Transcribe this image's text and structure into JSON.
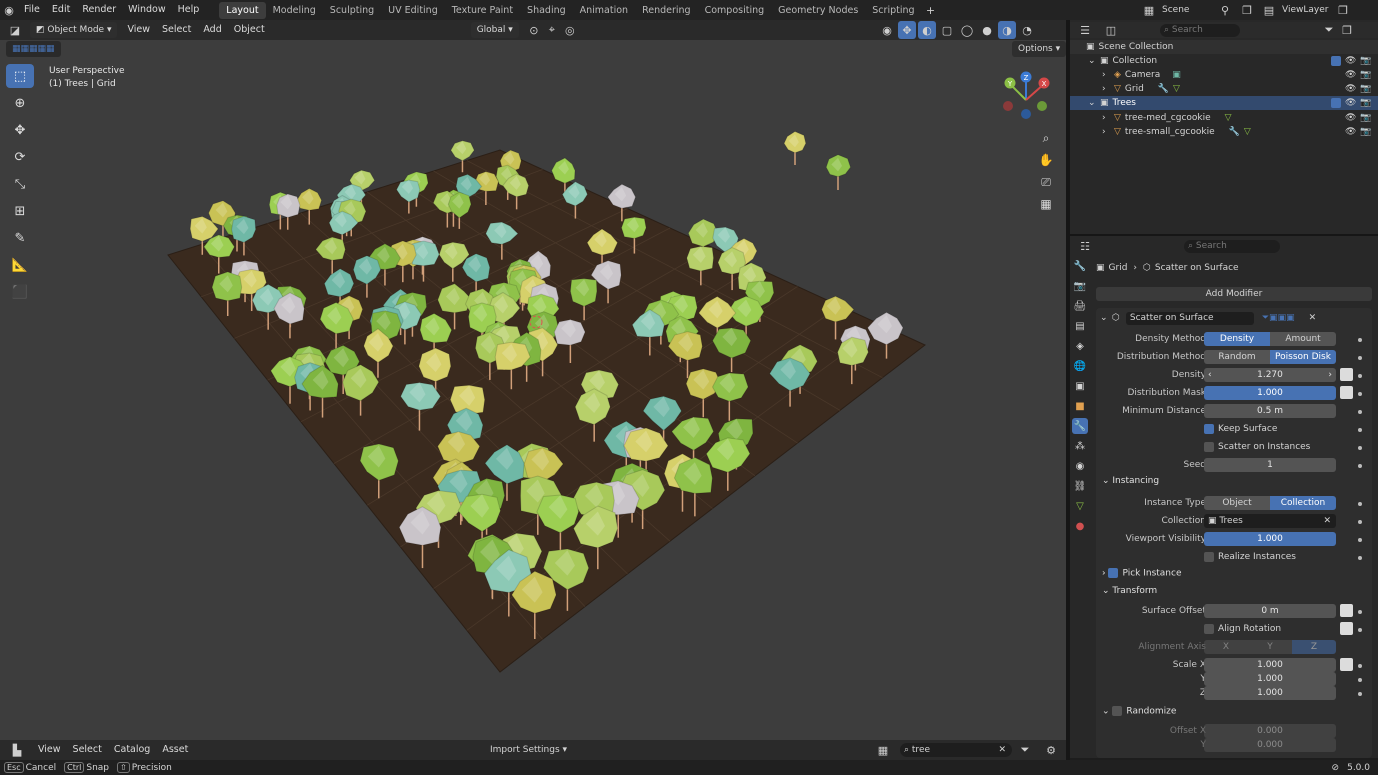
{
  "topbar": {
    "menus": [
      "File",
      "Edit",
      "Render",
      "Window",
      "Help"
    ],
    "workspaces": [
      "Layout",
      "Modeling",
      "Sculpting",
      "UV Editing",
      "Texture Paint",
      "Shading",
      "Animation",
      "Rendering",
      "Compositing",
      "Geometry Nodes",
      "Scripting"
    ],
    "active_workspace": "Layout",
    "scene": "Scene",
    "view_layer": "ViewLayer"
  },
  "viewport_header": {
    "mode": "Object Mode",
    "menus": [
      "View",
      "Select",
      "Add",
      "Object"
    ],
    "transform_orientation": "Global",
    "options": "Options"
  },
  "viewport": {
    "perspective": "User Perspective",
    "context": "(1) Trees | Grid",
    "gizmo_axes": [
      "Y",
      "X",
      "Z"
    ]
  },
  "outliner": {
    "search_placeholder": "Search",
    "root": "Scene Collection",
    "items": [
      {
        "label": "Collection"
      },
      {
        "label": "Camera"
      },
      {
        "label": "Grid"
      },
      {
        "label": "Trees"
      },
      {
        "label": "tree-med_cgcookie"
      },
      {
        "label": "tree-small_cgcookie"
      }
    ]
  },
  "properties": {
    "search_placeholder": "Search",
    "breadcrumb_object": "Grid",
    "breadcrumb_modifier": "Scatter on Surface",
    "add_modifier": "Add Modifier",
    "modifier_name": "Scatter on Surface",
    "density_method": {
      "label": "Density Method",
      "options": [
        "Density",
        "Amount"
      ],
      "selected": "Density"
    },
    "distribution_method": {
      "label": "Distribution Method",
      "options": [
        "Random",
        "Poisson Disk"
      ],
      "selected": "Poisson Disk"
    },
    "density": {
      "label": "Density",
      "value": "1.270"
    },
    "distribution_mask": {
      "label": "Distribution Mask",
      "value": "1.000"
    },
    "minimum_distance": {
      "label": "Minimum Distance",
      "value": "0.5 m"
    },
    "keep_surface": "Keep Surface",
    "scatter_on_instances": "Scatter on Instances",
    "seed": {
      "label": "Seed",
      "value": "1"
    },
    "instancing_section": "Instancing",
    "instance_type": {
      "label": "Instance Type",
      "options": [
        "Object",
        "Collection"
      ],
      "selected": "Collection"
    },
    "collection": {
      "label": "Collection",
      "value": "Trees"
    },
    "viewport_visibility": {
      "label": "Viewport Visibility",
      "value": "1.000"
    },
    "realize_instances": "Realize Instances",
    "pick_instance": "Pick Instance",
    "transform_section": "Transform",
    "surface_offset": {
      "label": "Surface Offset",
      "value": "0 m"
    },
    "align_rotation": "Align Rotation",
    "alignment_axis": {
      "label": "Alignment Axis",
      "options": [
        "X",
        "Y",
        "Z"
      ],
      "selected": "Z"
    },
    "scale_x": {
      "label": "Scale X",
      "value": "1.000"
    },
    "scale_y": {
      "label": "Y",
      "value": "1.000"
    },
    "scale_z": {
      "label": "Z",
      "value": "1.000"
    },
    "randomize_section": "Randomize",
    "offset_x": {
      "label": "Offset X",
      "value": "0.000"
    },
    "offset_y": {
      "label": "Y",
      "value": "0.000"
    }
  },
  "footer": {
    "menus": [
      "View",
      "Select",
      "Catalog",
      "Asset"
    ],
    "import_settings": "Import Settings",
    "search_value": "tree"
  },
  "statusbar": {
    "items": [
      {
        "key": "Esc",
        "label": "Cancel"
      },
      {
        "key": "Ctrl",
        "label": "Snap"
      },
      {
        "key": "⇧",
        "label": "Precision"
      }
    ],
    "version": "5.0.0"
  },
  "colors": {
    "accent": "#4772b3",
    "ground": "#3a2a1e",
    "tree_green": "#8fc24a",
    "tree_teal": "#6fb8a6"
  }
}
